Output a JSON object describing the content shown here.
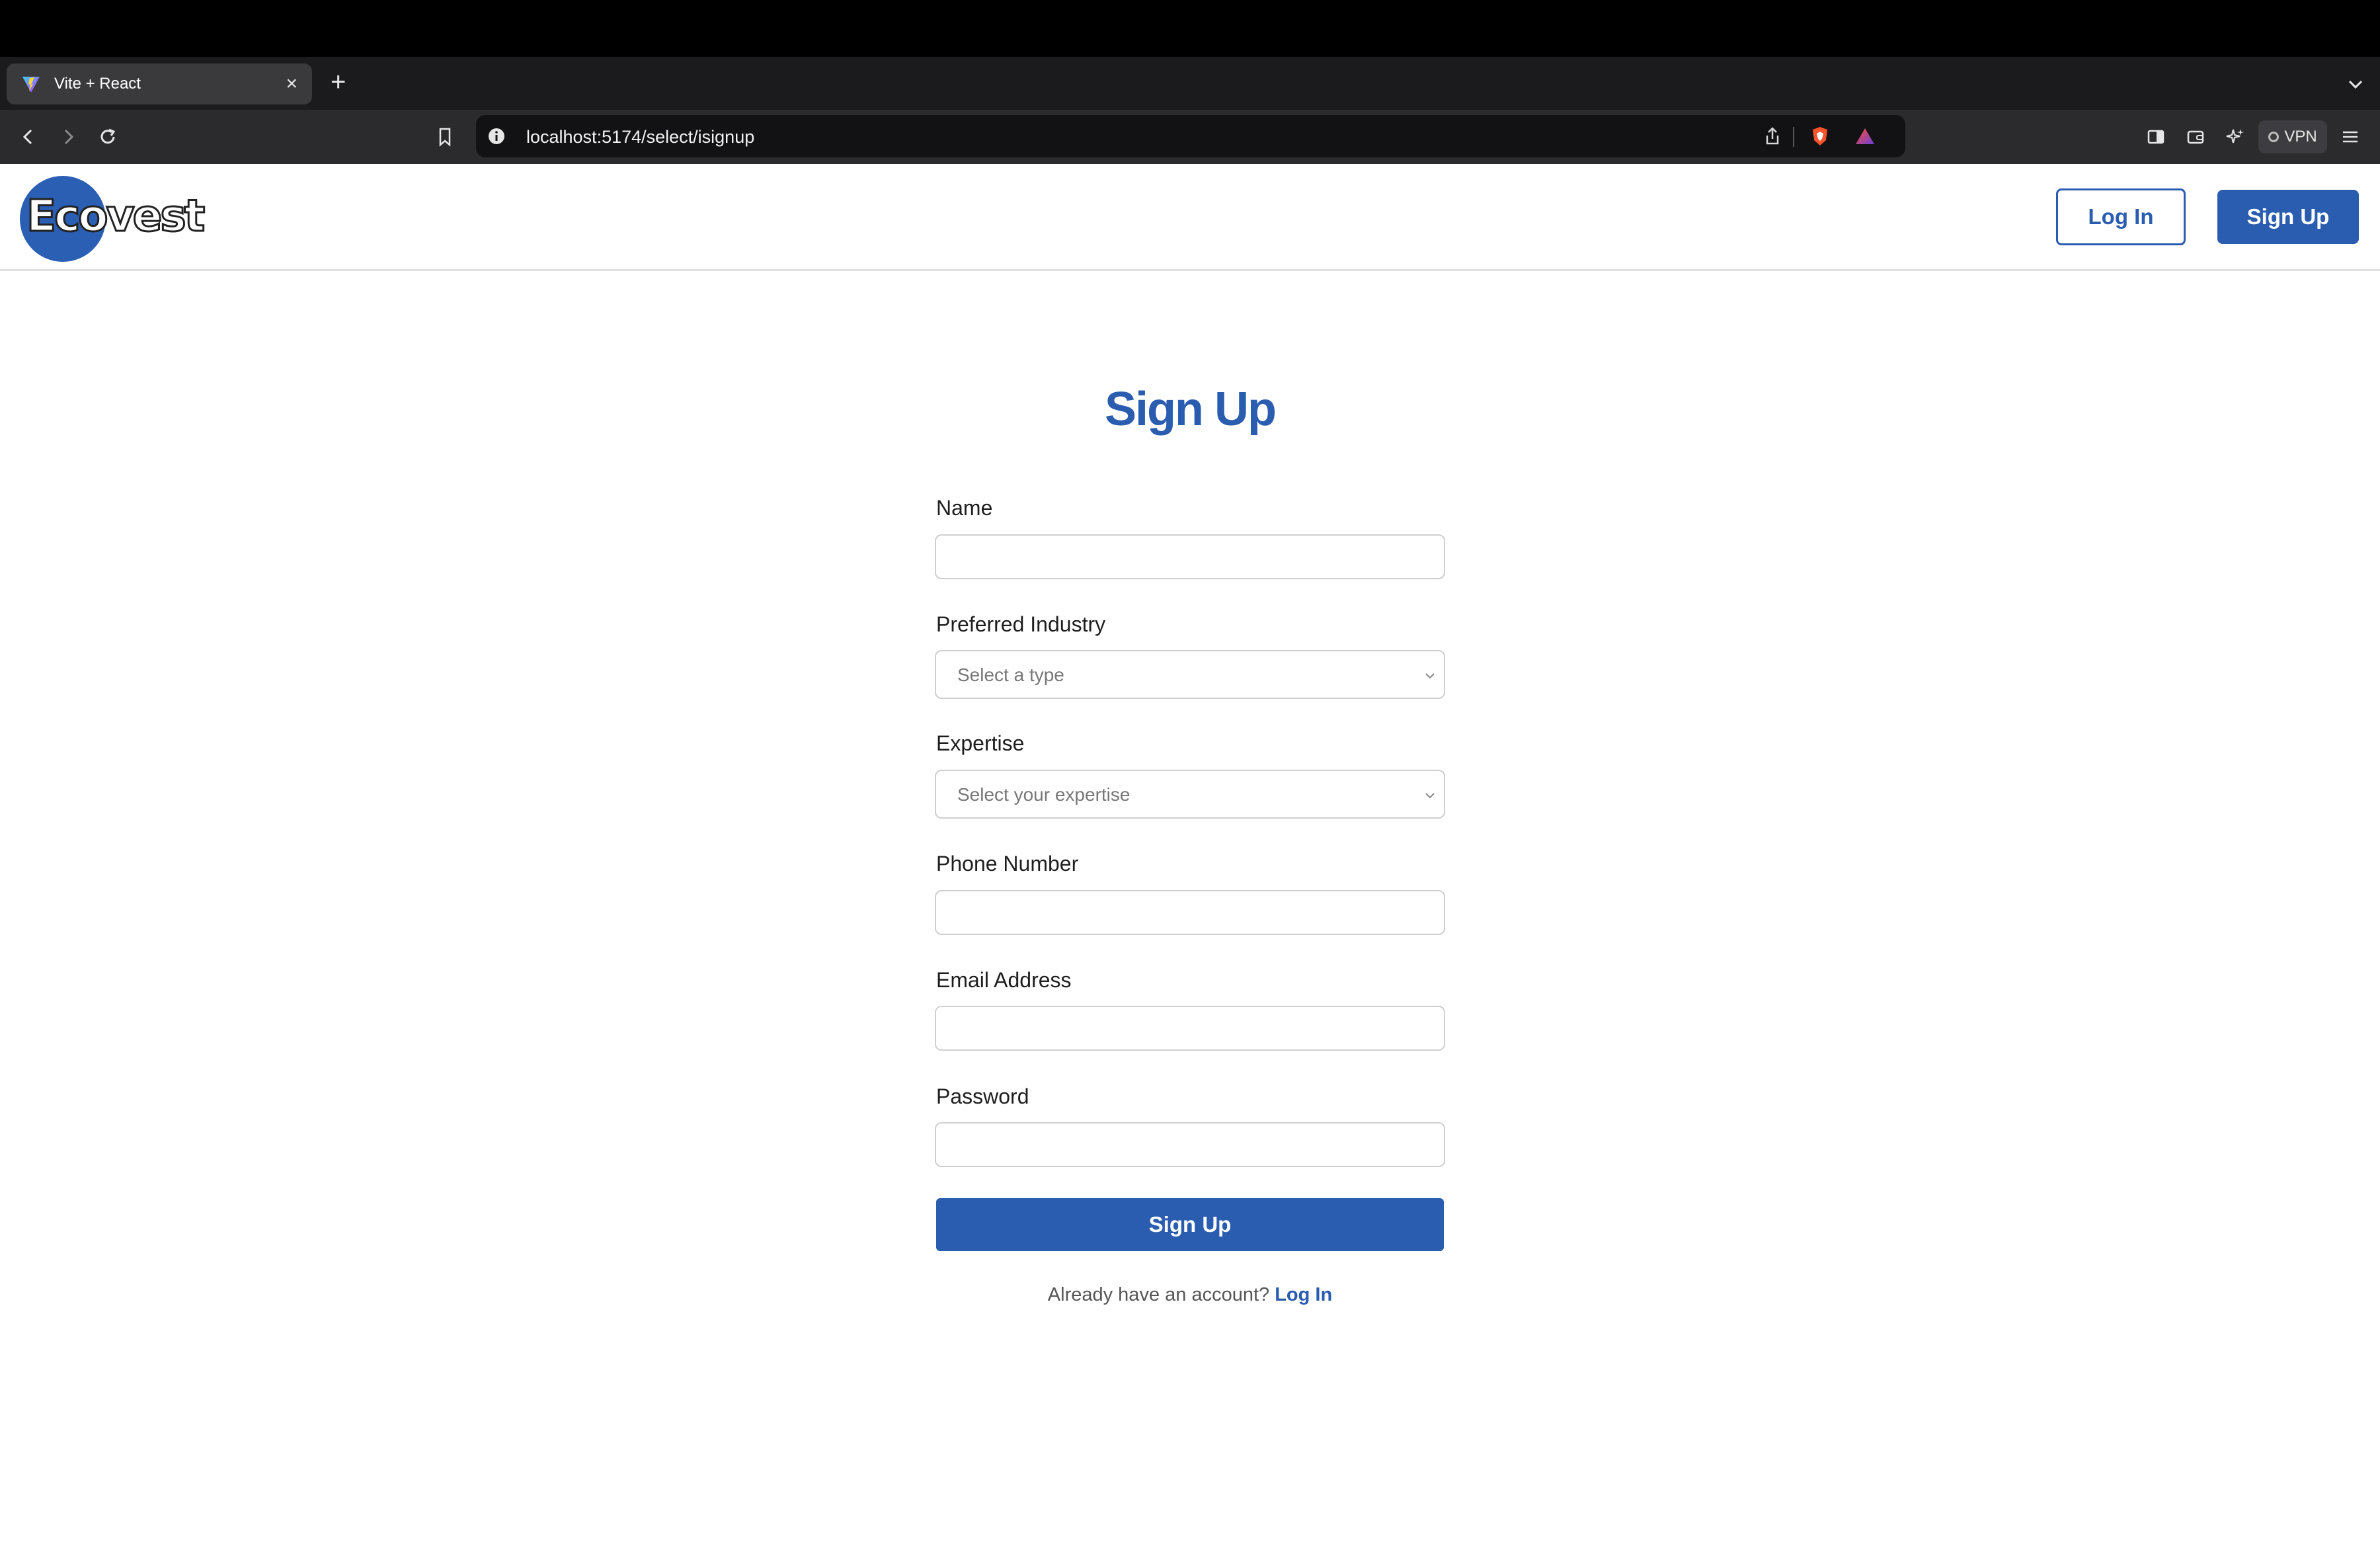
{
  "browser": {
    "tab_title": "Vite + React",
    "tab_close": "×",
    "new_tab": "+",
    "url": "localhost:5174/select/isignup",
    "vpn_label": "VPN"
  },
  "header": {
    "logo_text": "Ecovest",
    "login_label": "Log In",
    "signup_label": "Sign Up"
  },
  "form": {
    "title": "Sign Up",
    "name_label": "Name",
    "name_value": "",
    "industry_label": "Preferred Industry",
    "industry_placeholder": "Select a type",
    "expertise_label": "Expertise",
    "expertise_placeholder": "Select your expertise",
    "phone_label": "Phone Number",
    "phone_value": "",
    "email_label": "Email Address",
    "email_value": "",
    "password_label": "Password",
    "password_value": "",
    "submit_label": "Sign Up",
    "footer_prompt": "Already have an account?",
    "footer_link": "Log In"
  },
  "colors": {
    "brand_blue": "#2a5caf",
    "chrome_dark": "#2b2b2e"
  }
}
